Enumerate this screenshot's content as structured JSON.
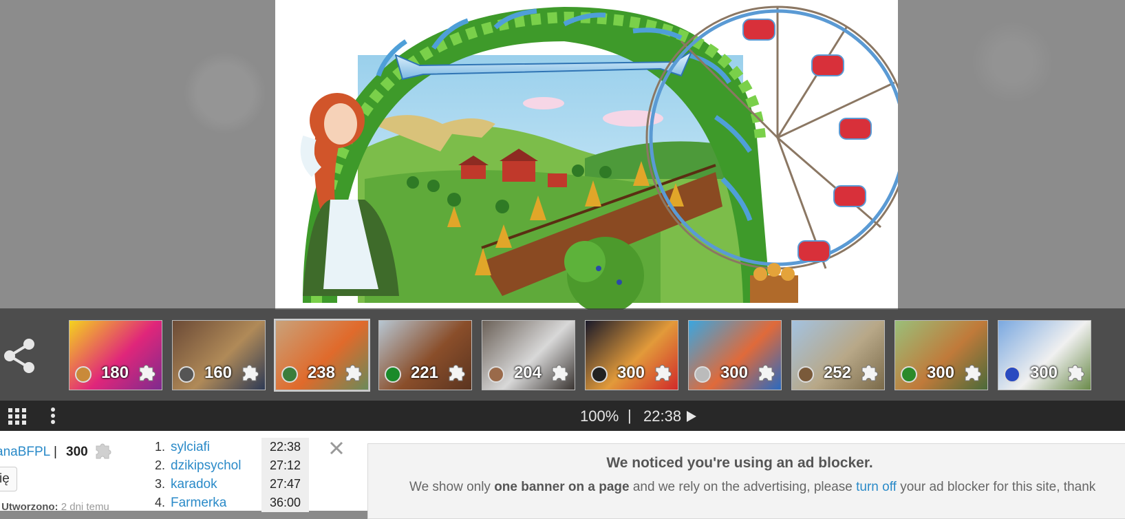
{
  "thumbnails": [
    {
      "count": "180",
      "bg": [
        "#f4d21f",
        "#e0267a",
        "#7d2b8e"
      ],
      "cat_color": "#c98a3a"
    },
    {
      "count": "160",
      "bg": [
        "#6b4a36",
        "#b08a58",
        "#2d3a55"
      ],
      "cat_color": "#555555"
    },
    {
      "count": "238",
      "bg": [
        "#c9a27a",
        "#e06a2b",
        "#6a8a5a"
      ],
      "cat_color": "#3b7d3b"
    },
    {
      "count": "221",
      "bg": [
        "#b7c6d2",
        "#8a4e2a",
        "#5a3420"
      ],
      "cat_color": "#1a8a2a"
    },
    {
      "count": "204",
      "bg": [
        "#6b6158",
        "#d8d8d8",
        "#3a3532"
      ],
      "cat_color": "#9a6a4a"
    },
    {
      "count": "300",
      "bg": [
        "#1a1a2a",
        "#e29a3a",
        "#d02a2a"
      ],
      "cat_color": "#222222"
    },
    {
      "count": "300",
      "bg": [
        "#3aa6e0",
        "#e06a3a",
        "#2a6ac0"
      ],
      "cat_color": "#bbbbbb"
    },
    {
      "count": "252",
      "bg": [
        "#a3c2e0",
        "#b8a888",
        "#7a6a4a"
      ],
      "cat_color": "#7a5a3a"
    },
    {
      "count": "300",
      "bg": [
        "#9abf7a",
        "#c07a3a",
        "#4a6a3a"
      ],
      "cat_color": "#2a8a2a"
    },
    {
      "count": "300",
      "bg": [
        "#7aa8e0",
        "#f0f0f0",
        "#6a8a4a"
      ],
      "cat_color": "#2a4ac0"
    }
  ],
  "toolbar": {
    "zoom": "100%",
    "separator": "|",
    "time": "22:38"
  },
  "info": {
    "author": "anaBFPL",
    "pipe": "|",
    "pieces": "300",
    "button_label": "ię",
    "created_label": "Utworzono:",
    "created_value": "2 dni temu"
  },
  "ranking": [
    {
      "rank": "1.",
      "name": "sylciafi",
      "time": "22:38"
    },
    {
      "rank": "2.",
      "name": "dzikipsychol",
      "time": "27:12"
    },
    {
      "rank": "3.",
      "name": "karadok",
      "time": "27:47"
    },
    {
      "rank": "4.",
      "name": "Farmerka",
      "time": "36:00"
    }
  ],
  "ad": {
    "title": "We noticed you're using an ad blocker.",
    "text_1": "We show only ",
    "text_bold": "one banner on a page",
    "text_2": " and we rely on the advertising, please ",
    "link": "turn off",
    "text_3": " your ad blocker for this site, thank"
  },
  "colors": {
    "link": "#2a8ac8",
    "toolbar_bg": "#282828",
    "strip_bg": "#3c3c3c"
  }
}
